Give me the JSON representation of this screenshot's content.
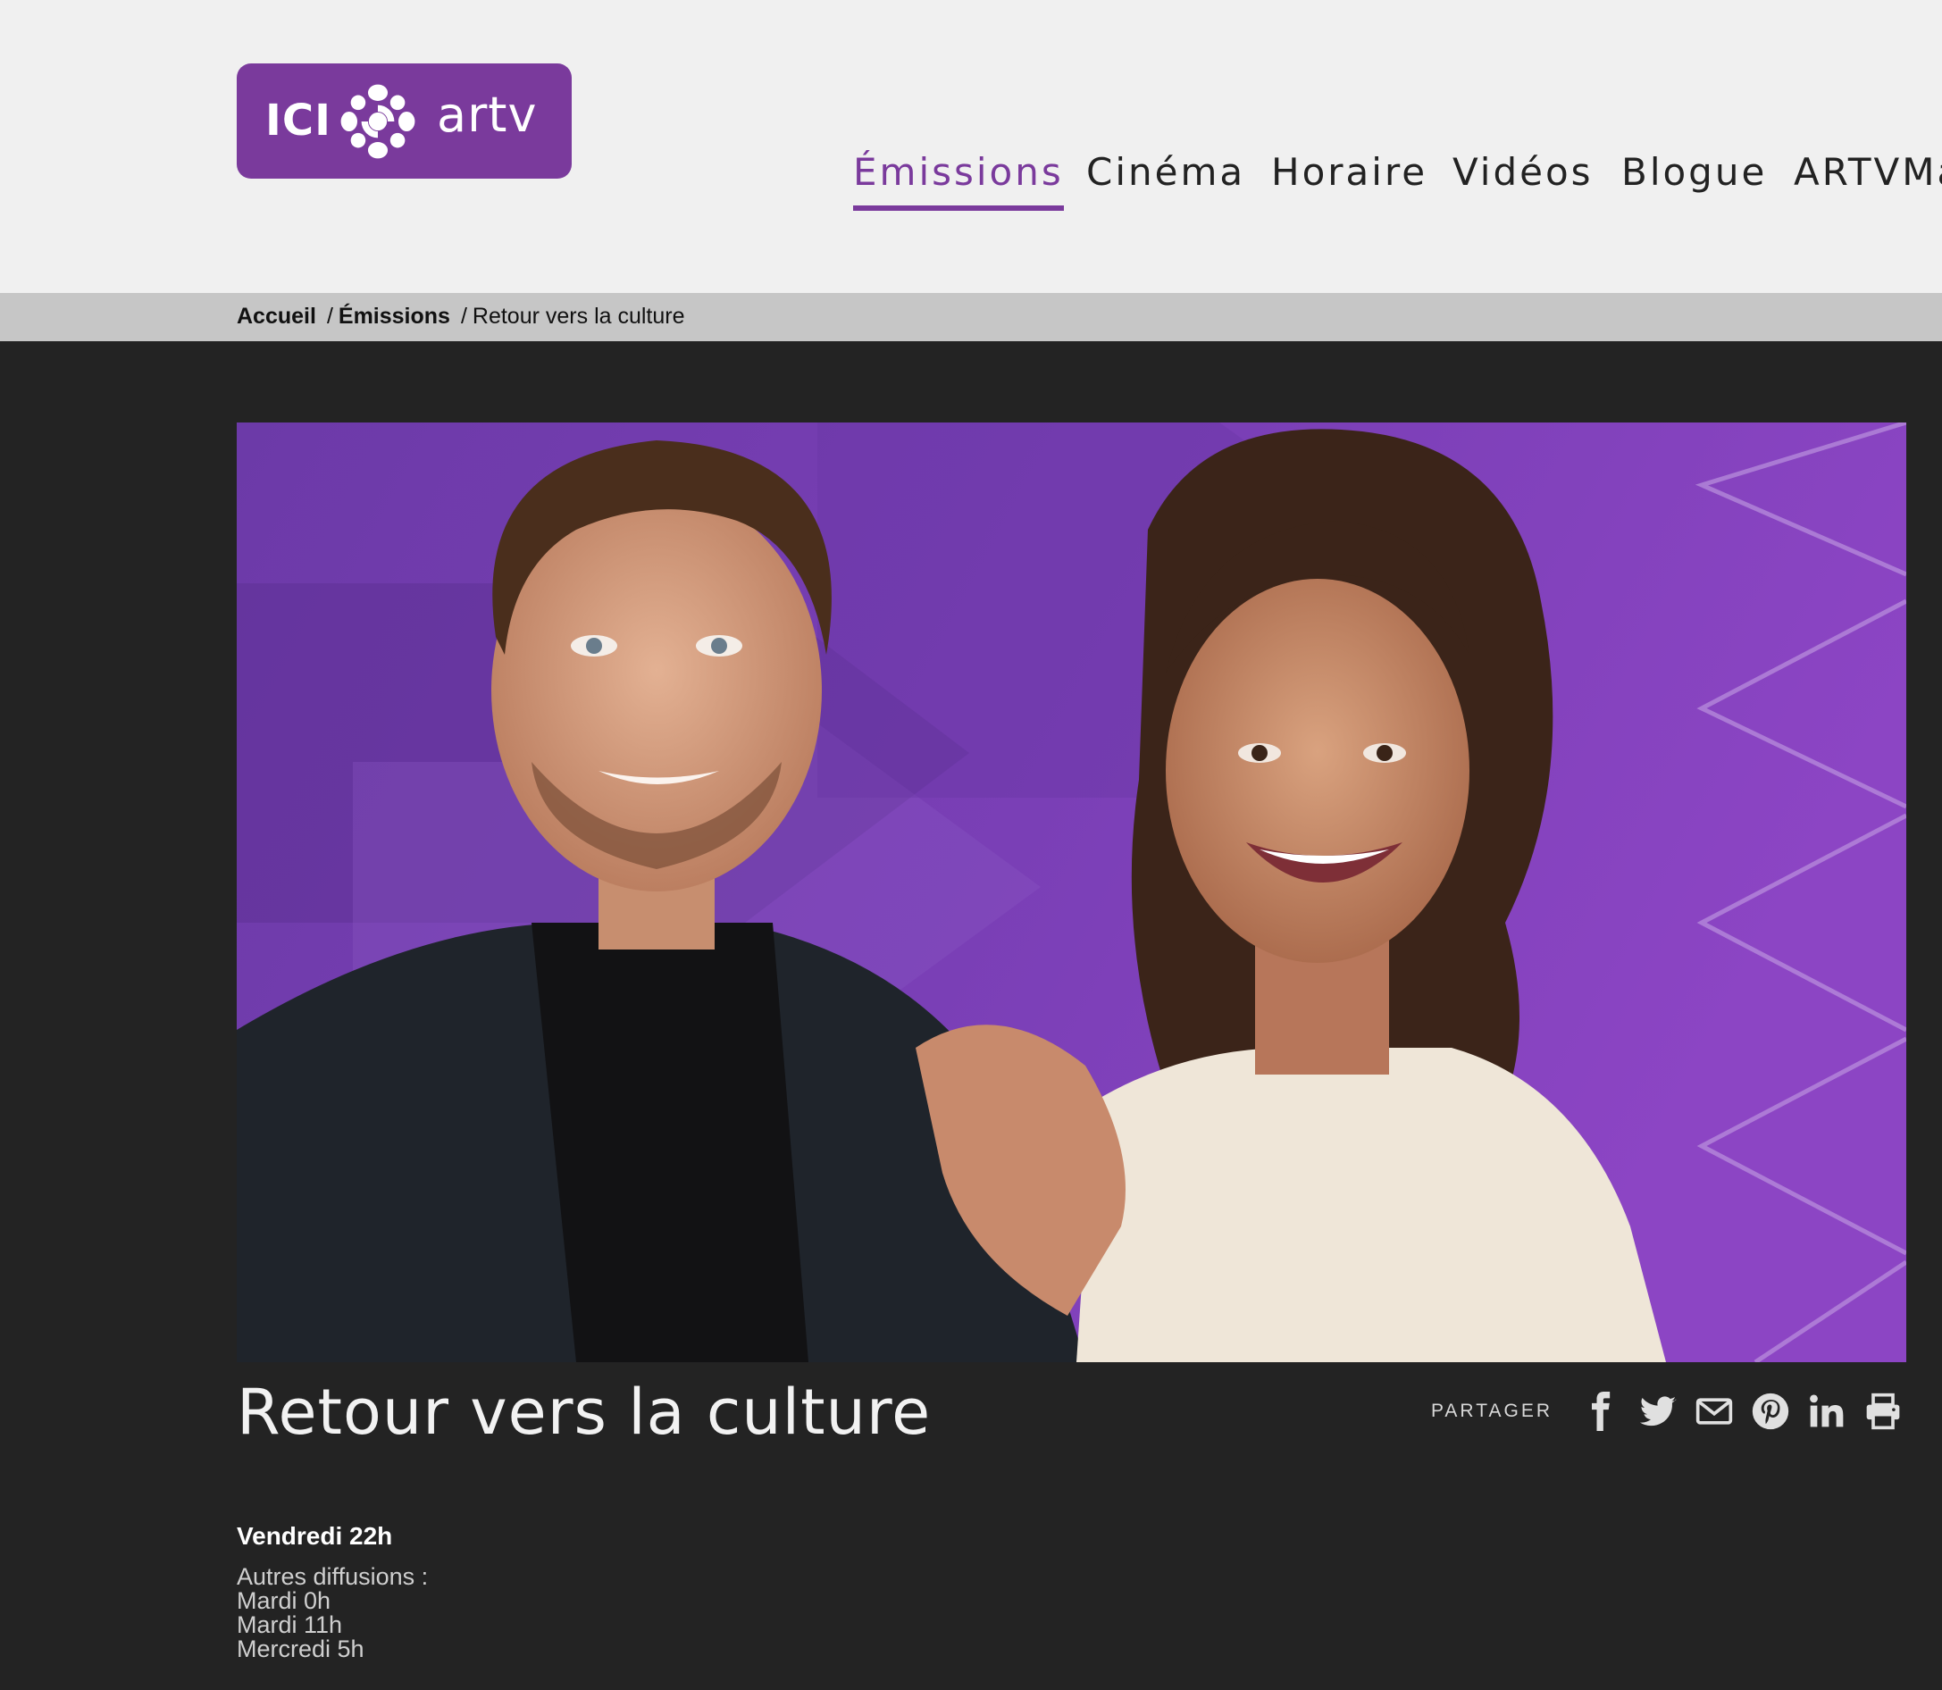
{
  "logo": {
    "ici": "ICI",
    "brand": "artv"
  },
  "nav": [
    {
      "label": "Émissions",
      "active": true
    },
    {
      "label": "Cinéma"
    },
    {
      "label": "Horaire"
    },
    {
      "label": "Vidéos"
    },
    {
      "label": "Blogue"
    },
    {
      "label": "ARTVMa"
    }
  ],
  "breadcrumb": {
    "home": "Accueil",
    "section": "Émissions",
    "current": "Retour vers la culture",
    "separator": "/"
  },
  "show": {
    "title": "Retour vers la culture",
    "primary_time": "Vendredi 22h",
    "other_label": "Autres diffusions :",
    "other_times": [
      "Mardi 0h",
      "Mardi 11h",
      "Mercredi 5h"
    ]
  },
  "share": {
    "label": "PARTAGER",
    "icons": [
      "facebook-icon",
      "twitter-icon",
      "email-icon",
      "pinterest-icon",
      "linkedin-icon",
      "print-icon"
    ]
  },
  "colors": {
    "brand_purple": "#7a3a9c",
    "header_bg": "#f0f0f0",
    "breadcrumb_bg": "#c6c6c6",
    "page_bg": "#232323",
    "hero_purple": "#7b3fb2"
  }
}
